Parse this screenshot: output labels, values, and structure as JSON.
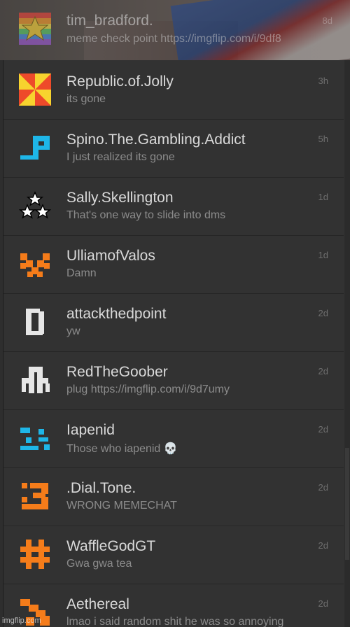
{
  "chats": [
    {
      "username": "tim_bradford.",
      "message": "meme check point https://imgflip.com/i/9df8",
      "time": "",
      "avatar": "rainbow-star-icon"
    },
    {
      "username": "Republic.of.Jolly",
      "message": "its gone",
      "time": "3h",
      "avatar": "pinwheel-icon"
    },
    {
      "username": "Spino.The.Gambling.Addict",
      "message": "I just realized its gone",
      "time": "5h",
      "avatar": "blue-pixel-icon"
    },
    {
      "username": "Sally.Skellington",
      "message": "That's one way to slide into dms",
      "time": "1d",
      "avatar": "three-stars-icon"
    },
    {
      "username": "UlliamofValos",
      "message": "Damn",
      "time": "1d",
      "avatar": "orange-pixel-icon"
    },
    {
      "username": "attackthedpoint",
      "message": "yw",
      "time": "2d",
      "avatar": "white-pixel-d-icon"
    },
    {
      "username": "RedTheGoober",
      "message": "plug https://imgflip.com/i/9d7umy",
      "time": "2d",
      "avatar": "white-pixel-icon"
    },
    {
      "username": "Iapenid",
      "message": "Those who iapenid 💀",
      "time": "2d",
      "avatar": "cyan-pixel-icon"
    },
    {
      "username": ".Dial.Tone.",
      "message": "WRONG MEMECHAT",
      "time": "2d",
      "avatar": "orange-three-icon"
    },
    {
      "username": "WaffleGodGT",
      "message": "Gwa gwa tea",
      "time": "2d",
      "avatar": "hash-icon"
    },
    {
      "username": "Aethereal",
      "message": "lmao i said random shit he was so annoying",
      "time": "2d",
      "avatar": "orange-pixel-icon"
    }
  ],
  "watermark": "imgflip.com",
  "colors": {
    "panel": "#323232",
    "name": "#d9d9d9",
    "message": "#8c8c8c",
    "time": "#6f6f6f",
    "orange": "#f57c1a",
    "cyan": "#1eb6e8"
  }
}
